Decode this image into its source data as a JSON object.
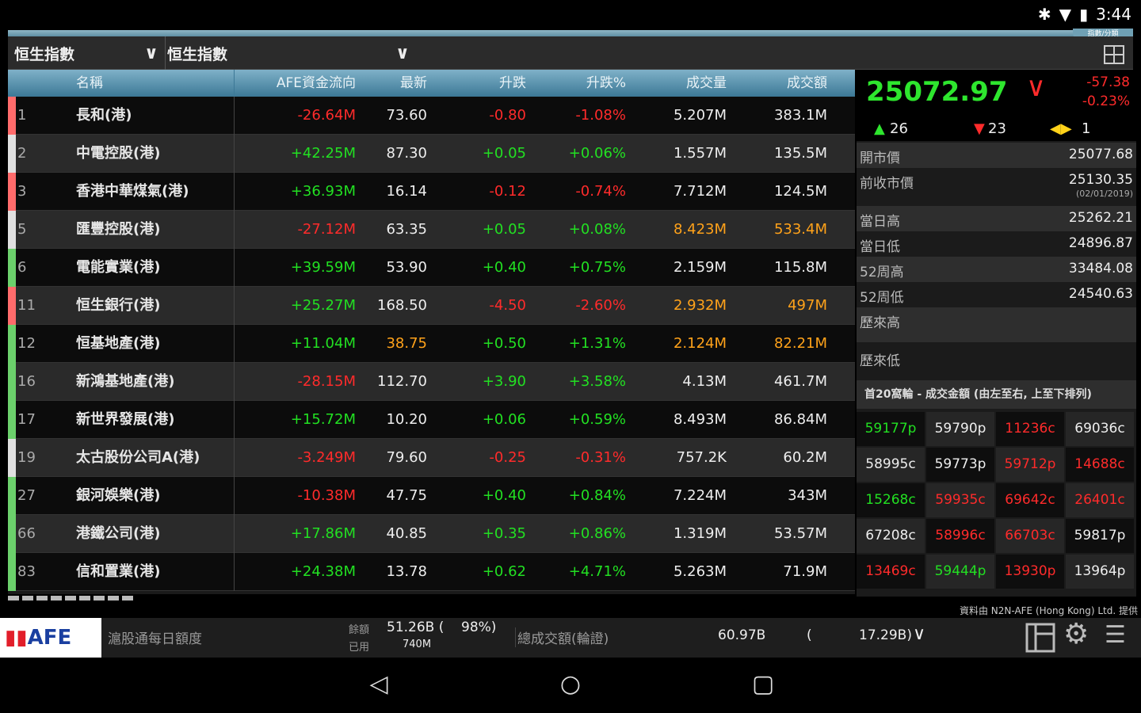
{
  "status": {
    "time": "3:44"
  },
  "header": {
    "tag": "指數/分類",
    "selector1": "恒生指數",
    "selector2": "恒生指數"
  },
  "table": {
    "columns": [
      "名稱",
      "AFE資金流向",
      "最新",
      "升跌",
      "升跌%",
      "成交量",
      "成交額"
    ],
    "rows": [
      {
        "code": "1",
        "name": "長和(港)",
        "afe": "-26.64M",
        "last": "73.60",
        "chg": "-0.80",
        "pct": "-1.08%",
        "vol": "5.207M",
        "amt": "383.1M",
        "mark": "#ff6b6b",
        "afe_c": "red",
        "last_c": "white",
        "chg_c": "red",
        "vol_c": "white",
        "amt_c": "white"
      },
      {
        "code": "2",
        "name": "中電控股(港)",
        "afe": "+42.25M",
        "last": "87.30",
        "chg": "+0.05",
        "pct": "+0.06%",
        "vol": "1.557M",
        "amt": "135.5M",
        "mark": "#e0e0e0",
        "afe_c": "green",
        "last_c": "white",
        "chg_c": "green",
        "vol_c": "white",
        "amt_c": "white"
      },
      {
        "code": "3",
        "name": "香港中華煤氣(港)",
        "afe": "+36.93M",
        "last": "16.14",
        "chg": "-0.12",
        "pct": "-0.74%",
        "vol": "7.712M",
        "amt": "124.5M",
        "mark": "#ff6b6b",
        "afe_c": "green",
        "last_c": "white",
        "chg_c": "red",
        "vol_c": "white",
        "amt_c": "white"
      },
      {
        "code": "5",
        "name": "匯豐控股(港)",
        "afe": "-27.12M",
        "last": "63.35",
        "chg": "+0.05",
        "pct": "+0.08%",
        "vol": "8.423M",
        "amt": "533.4M",
        "mark": "#e0e0e0",
        "afe_c": "red",
        "last_c": "white",
        "chg_c": "green",
        "vol_c": "orange",
        "amt_c": "orange"
      },
      {
        "code": "6",
        "name": "電能實業(港)",
        "afe": "+39.59M",
        "last": "53.90",
        "chg": "+0.40",
        "pct": "+0.75%",
        "vol": "2.159M",
        "amt": "115.8M",
        "mark": "#6bd06b",
        "afe_c": "green",
        "last_c": "white",
        "chg_c": "green",
        "vol_c": "white",
        "amt_c": "white"
      },
      {
        "code": "11",
        "name": "恒生銀行(港)",
        "afe": "+25.27M",
        "last": "168.50",
        "chg": "-4.50",
        "pct": "-2.60%",
        "vol": "2.932M",
        "amt": "497M",
        "mark": "#ff6b6b",
        "afe_c": "green",
        "last_c": "white",
        "chg_c": "red",
        "vol_c": "orange",
        "amt_c": "orange"
      },
      {
        "code": "12",
        "name": "恒基地產(港)",
        "afe": "+11.04M",
        "last": "38.75",
        "chg": "+0.50",
        "pct": "+1.31%",
        "vol": "2.124M",
        "amt": "82.21M",
        "mark": "#6bd06b",
        "afe_c": "green",
        "last_c": "orange",
        "chg_c": "green",
        "vol_c": "orange",
        "amt_c": "orange"
      },
      {
        "code": "16",
        "name": "新鴻基地產(港)",
        "afe": "-28.15M",
        "last": "112.70",
        "chg": "+3.90",
        "pct": "+3.58%",
        "vol": "4.13M",
        "amt": "461.7M",
        "mark": "#6bd06b",
        "afe_c": "red",
        "last_c": "white",
        "chg_c": "green",
        "vol_c": "white",
        "amt_c": "white"
      },
      {
        "code": "17",
        "name": "新世界發展(港)",
        "afe": "+15.72M",
        "last": "10.20",
        "chg": "+0.06",
        "pct": "+0.59%",
        "vol": "8.493M",
        "amt": "86.84M",
        "mark": "#6bd06b",
        "afe_c": "green",
        "last_c": "white",
        "chg_c": "green",
        "vol_c": "white",
        "amt_c": "white"
      },
      {
        "code": "19",
        "name": "太古股份公司A(港)",
        "afe": "-3.249M",
        "last": "79.60",
        "chg": "-0.25",
        "pct": "-0.31%",
        "vol": "757.2K",
        "amt": "60.2M",
        "mark": "#e0e0e0",
        "afe_c": "red",
        "last_c": "white",
        "chg_c": "red",
        "vol_c": "white",
        "amt_c": "white"
      },
      {
        "code": "27",
        "name": "銀河娛樂(港)",
        "afe": "-10.38M",
        "last": "47.75",
        "chg": "+0.40",
        "pct": "+0.84%",
        "vol": "7.224M",
        "amt": "343M",
        "mark": "#6bd06b",
        "afe_c": "red",
        "last_c": "white",
        "chg_c": "green",
        "vol_c": "white",
        "amt_c": "white"
      },
      {
        "code": "66",
        "name": "港鐵公司(港)",
        "afe": "+17.86M",
        "last": "40.85",
        "chg": "+0.35",
        "pct": "+0.86%",
        "vol": "1.319M",
        "amt": "53.57M",
        "mark": "#6bd06b",
        "afe_c": "green",
        "last_c": "white",
        "chg_c": "green",
        "vol_c": "white",
        "amt_c": "white"
      },
      {
        "code": "83",
        "name": "信和置業(港)",
        "afe": "+24.38M",
        "last": "13.78",
        "chg": "+0.62",
        "pct": "+4.71%",
        "vol": "5.263M",
        "amt": "71.9M",
        "mark": "#6bd06b",
        "afe_c": "green",
        "last_c": "white",
        "chg_c": "green",
        "vol_c": "white",
        "amt_c": "white"
      }
    ]
  },
  "index": {
    "value": "25072.97",
    "change": "-57.38",
    "change_pct": "-0.23%",
    "advances": "26",
    "declines": "23",
    "unchanged": "1"
  },
  "stats": [
    {
      "label": "開市價",
      "value": "25077.68"
    },
    {
      "label": "前收市價",
      "value": "25130.35",
      "sub": "(02/01/2019)"
    },
    {
      "label": "當日高",
      "value": "25262.21"
    },
    {
      "label": "當日低",
      "value": "24896.87"
    },
    {
      "label": "52周高",
      "value": "33484.08"
    },
    {
      "label": "52周低",
      "value": "24540.63"
    },
    {
      "label": "歷來高",
      "value": ""
    },
    {
      "label": "歷來低",
      "value": ""
    }
  ],
  "top20": {
    "title": "首20窩輪 - 成交金額 (由左至右, 上至下排列)",
    "cells": [
      {
        "t": "59177p",
        "c": "green"
      },
      {
        "t": "59790p",
        "c": "white"
      },
      {
        "t": "11236c",
        "c": "red"
      },
      {
        "t": "69036c",
        "c": "white"
      },
      {
        "t": "58995c",
        "c": "white"
      },
      {
        "t": "59773p",
        "c": "white"
      },
      {
        "t": "59712p",
        "c": "red"
      },
      {
        "t": "14688c",
        "c": "red"
      },
      {
        "t": "15268c",
        "c": "green"
      },
      {
        "t": "59935c",
        "c": "red"
      },
      {
        "t": "69642c",
        "c": "red"
      },
      {
        "t": "26401c",
        "c": "red"
      },
      {
        "t": "67208c",
        "c": "white"
      },
      {
        "t": "58996c",
        "c": "red"
      },
      {
        "t": "66703c",
        "c": "red"
      },
      {
        "t": "59817p",
        "c": "white"
      },
      {
        "t": "13469c",
        "c": "red"
      },
      {
        "t": "59444p",
        "c": "green"
      },
      {
        "t": "13930p",
        "c": "red"
      },
      {
        "t": "13964p",
        "c": "white"
      }
    ]
  },
  "source": "資料由 N2N-AFE (Hong Kong) Ltd. 提供",
  "footer": {
    "logo": "AFE",
    "quota_label": "滬股通每日額度",
    "balance_label": "餘額",
    "used_label": "已用",
    "balance": "51.26B (",
    "balance_pct": "98%)",
    "used": "740M",
    "turnover_label": "總成交額(輪證)",
    "turnover": "60.97B",
    "paren_open": "(",
    "warrants": "17.29B)"
  },
  "colors": {
    "up": "#22e022",
    "down": "#ff2b2b",
    "highlight": "#ffa21a",
    "header_blue": "#5a96b4"
  }
}
